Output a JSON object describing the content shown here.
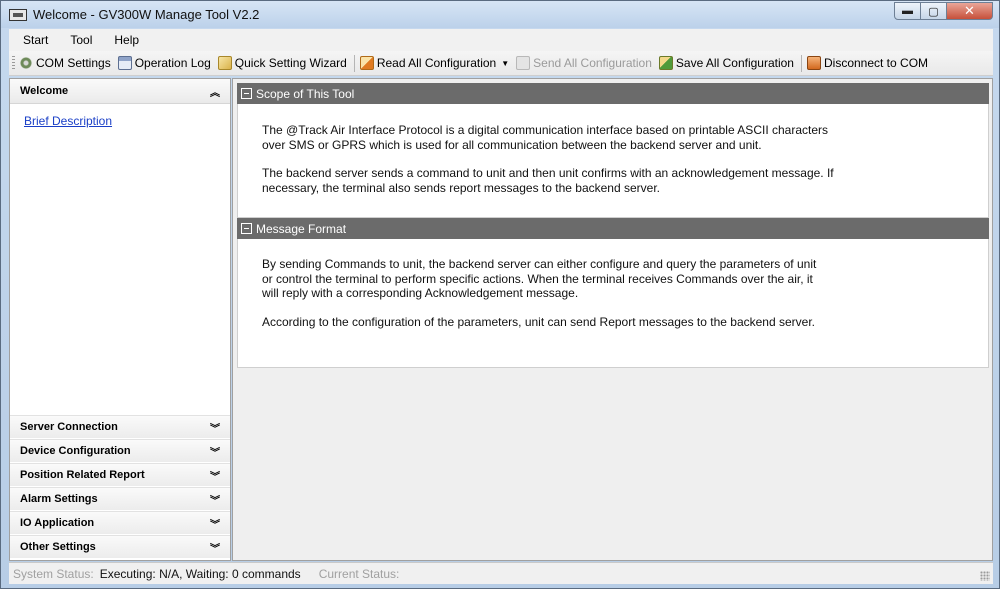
{
  "window": {
    "title": "Welcome - GV300W Manage Tool V2.2"
  },
  "window_buttons": {
    "minimize": "▬",
    "maximize": "▢",
    "close": "✕"
  },
  "menu": [
    "Start",
    "Tool",
    "Help"
  ],
  "toolbar": {
    "com_settings": "COM Settings",
    "operation_log": "Operation Log",
    "quick_setting_wizard": "Quick Setting Wizard",
    "read_all": "Read All Configuration",
    "send_all": "Send All Configuration",
    "save_all": "Save All Configuration",
    "disconnect": "Disconnect to COM"
  },
  "left_panel": {
    "welcome_header": "Welcome",
    "brief_link": "Brief Description",
    "sections": [
      "Server Connection",
      "Device Configuration",
      "Position Related Report",
      "Alarm Settings",
      "IO Application",
      "Other Settings"
    ]
  },
  "main": {
    "scope": {
      "title": "Scope of This Tool",
      "p1": "The @Track Air Interface Protocol is a digital communication interface based on printable ASCII characters over SMS or GPRS which is used for all communication between the backend server and unit.",
      "p2": "The backend server sends a command to unit and then unit confirms with an acknowledgement message. If necessary, the terminal also sends report messages to the backend server."
    },
    "format": {
      "title": "Message Format",
      "p1": "By sending Commands to unit, the backend server can either configure and query the parameters of unit or control the terminal to perform specific actions. When the terminal receives Commands over the air, it will reply with a corresponding Acknowledgement message.",
      "p2": "According to the configuration of the parameters, unit can send Report messages to the backend server."
    }
  },
  "status": {
    "system_label": "System Status:",
    "system_value": "Executing: N/A, Waiting: 0 commands",
    "current_label": "Current Status:"
  },
  "colors": {
    "section_header": "#6b6b6b",
    "link": "#1a3fc7",
    "close_button": "#c7503a"
  }
}
